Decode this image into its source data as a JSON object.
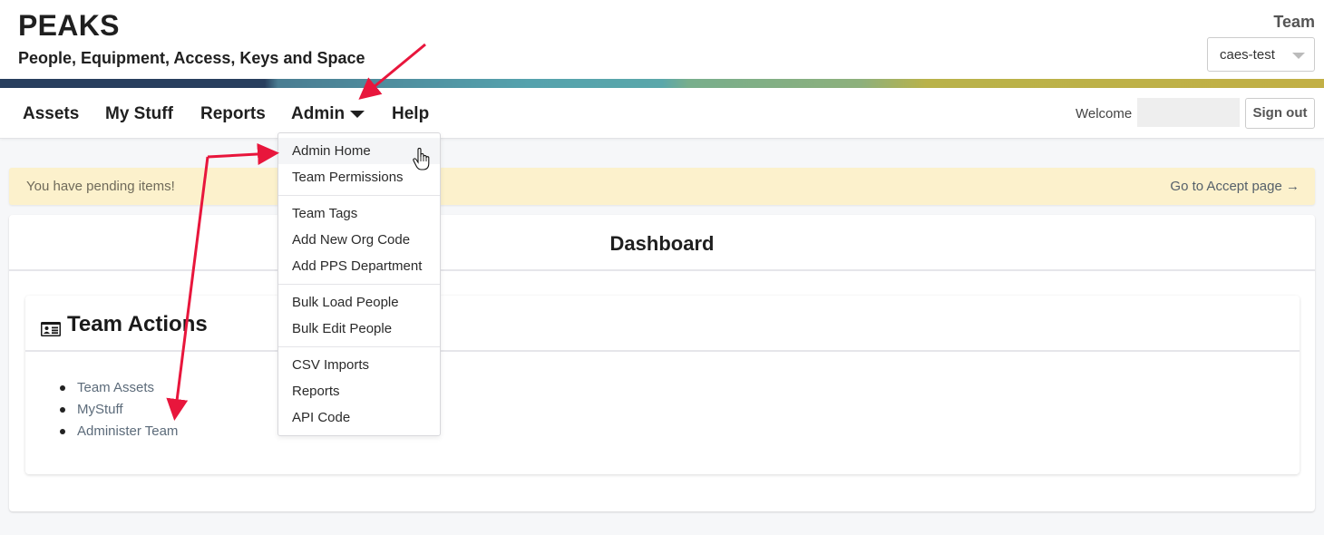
{
  "header": {
    "app_title": "PEAKS",
    "app_subtitle": "People, Equipment, Access, Keys and Space",
    "team_label": "Team",
    "team_select": {
      "selected": "caes-test",
      "icon": "chevron-down-icon"
    }
  },
  "band_colors": [
    "#283f5e",
    "#4a7d92",
    "#55a2ad",
    "#8db07c",
    "#c2b046"
  ],
  "nav": {
    "items": [
      {
        "label": "Assets"
      },
      {
        "label": "My Stuff"
      },
      {
        "label": "Reports"
      },
      {
        "label": "Admin",
        "has_dropdown": true,
        "expanded": true
      },
      {
        "label": "Help"
      }
    ],
    "welcome_label": "Welcome",
    "welcome_name": "",
    "sign_out_label": "Sign out"
  },
  "admin_menu": {
    "groups": [
      [
        "Admin Home",
        "Team Permissions"
      ],
      [
        "Team Tags",
        "Add New Org Code",
        "Add PPS Department"
      ],
      [
        "Bulk Load People",
        "Bulk Edit People"
      ],
      [
        "CSV Imports",
        "Reports",
        "API Code"
      ]
    ],
    "hovered": "Admin Home"
  },
  "alert": {
    "message": "You have pending items!",
    "link_label": "Go to Accept page →",
    "bg_color": "#fcf1cc"
  },
  "dashboard": {
    "title": "Dashboard",
    "team_actions": {
      "title": "Team Actions",
      "icon": "id-card-icon",
      "links": [
        "Team Assets",
        "MyStuff",
        "Administer Team"
      ]
    }
  },
  "annotations": {
    "arrow_color": "#e8163c",
    "arrows": [
      "points-to-admin-menu",
      "points-to-admin-home",
      "points-to-administer-team"
    ]
  }
}
